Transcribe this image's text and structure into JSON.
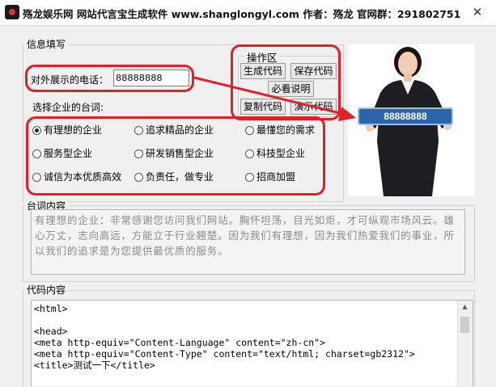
{
  "window": {
    "title": "殇龙娱乐网 网站代言宝生成软件  www.shanglongyl.com  作者：殇龙  官网群：291802751",
    "close_glyph": "✕"
  },
  "info": {
    "legend": "信息填写",
    "phone_label": "对外展示的电话：",
    "phone_value": "88888888",
    "slogan_label": "选择企业的台词:"
  },
  "ops": {
    "legend": "操作区",
    "generate": "生成代码",
    "save": "保存代码",
    "help": "必看说明",
    "copy": "复制代码",
    "demo": "演示代码"
  },
  "photo": {
    "banner_text": "88888888"
  },
  "slogans": [
    {
      "label": "有理想的企业",
      "checked": true
    },
    {
      "label": "追求精品的企业",
      "checked": false
    },
    {
      "label": "最懂您的需求",
      "checked": false
    },
    {
      "label": "服务型企业",
      "checked": false
    },
    {
      "label": "研发销售型企业",
      "checked": false
    },
    {
      "label": "科技型企业",
      "checked": false
    },
    {
      "label": "诚信为本优质高效",
      "checked": false
    },
    {
      "label": "负责任，做专业",
      "checked": false
    },
    {
      "label": "招商加盟",
      "checked": false
    }
  ],
  "script": {
    "legend": "台词内容",
    "text": "有理想的企业：非常感谢您访问我们网站。胸怀坦荡，目光如炬，才可纵观市场风云。雄心万丈，志向高远，方能立于行业翘楚。因为我们有理想，因为我们热爱我们的事业，所以我们的追求是为您提供最优质的服务。"
  },
  "code": {
    "legend": "代码内容",
    "text": "<html>\n\n<head>\n<meta http-equiv=\"Content-Language\" content=\"zh-cn\">\n<meta http-equiv=\"Content-Type\" content=\"text/html; charset=gb2312\">\n<title>测试一下</title>"
  },
  "colors": {
    "annotation_red": "#e0202a",
    "banner_blue": "#2d63a8"
  }
}
